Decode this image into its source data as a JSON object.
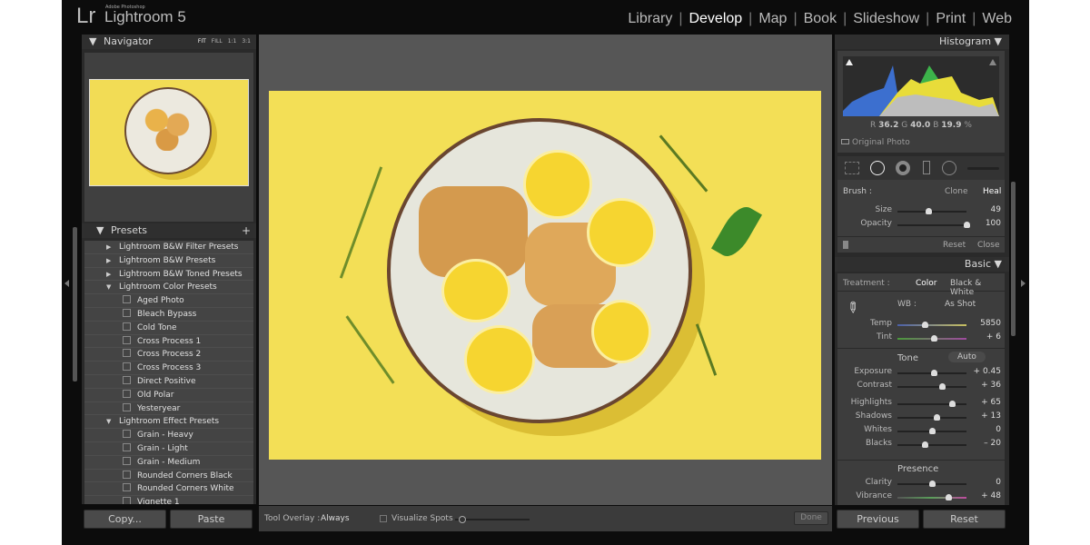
{
  "app": {
    "logo": "Lr",
    "vendor": "Adobe Photoshop",
    "name": "Lightroom 5"
  },
  "modules": [
    {
      "label": "Library"
    },
    {
      "label": "Develop",
      "active": true
    },
    {
      "label": "Map"
    },
    {
      "label": "Book"
    },
    {
      "label": "Slideshow"
    },
    {
      "label": "Print"
    },
    {
      "label": "Web"
    }
  ],
  "navigator": {
    "title": "Navigator",
    "zoom_options": [
      "FIT",
      "FILL",
      "1:1",
      "3:1"
    ]
  },
  "presets": {
    "title": "Presets",
    "add": "+",
    "items": [
      {
        "label": "Lightroom B&W Filter Presets",
        "type": "folder",
        "expanded": false
      },
      {
        "label": "Lightroom B&W Presets",
        "type": "folder",
        "expanded": false
      },
      {
        "label": "Lightroom B&W Toned Presets",
        "type": "folder",
        "expanded": false
      },
      {
        "label": "Lightroom Color Presets",
        "type": "folder",
        "expanded": true
      },
      {
        "label": "Aged Photo",
        "type": "preset"
      },
      {
        "label": "Bleach Bypass",
        "type": "preset"
      },
      {
        "label": "Cold Tone",
        "type": "preset"
      },
      {
        "label": "Cross Process 1",
        "type": "preset"
      },
      {
        "label": "Cross Process 2",
        "type": "preset"
      },
      {
        "label": "Cross Process 3",
        "type": "preset"
      },
      {
        "label": "Direct Positive",
        "type": "preset"
      },
      {
        "label": "Old Polar",
        "type": "preset"
      },
      {
        "label": "Yesteryear",
        "type": "preset"
      },
      {
        "label": "Lightroom Effect Presets",
        "type": "folder",
        "expanded": true
      },
      {
        "label": "Grain - Heavy",
        "type": "preset"
      },
      {
        "label": "Grain - Light",
        "type": "preset"
      },
      {
        "label": "Grain - Medium",
        "type": "preset"
      },
      {
        "label": "Rounded Corners Black",
        "type": "preset"
      },
      {
        "label": "Rounded Corners White",
        "type": "preset"
      },
      {
        "label": "Vignette 1",
        "type": "preset"
      }
    ]
  },
  "left_buttons": {
    "copy": "Copy...",
    "paste": "Paste"
  },
  "toolbar": {
    "tool_overlay_label": "Tool Overlay :",
    "tool_overlay_value": "Always",
    "visualize_spots": "Visualize Spots",
    "visualize_checked": false,
    "threshold_level": 0.1,
    "done": "Done"
  },
  "histogram": {
    "title": "Histogram",
    "r_label": "R",
    "r": "36.2",
    "g_label": "G",
    "g": "40.0",
    "b_label": "B",
    "b": "19.9",
    "unit": "%",
    "original_photo": "Original Photo"
  },
  "brush": {
    "label": "Brush :",
    "clone": "Clone",
    "heal": "Heal",
    "active": "Heal",
    "sliders": [
      {
        "label": "Size",
        "value": "49",
        "level": 0.45
      },
      {
        "label": "Opacity",
        "value": "100",
        "level": 1.0
      }
    ],
    "reset": "Reset",
    "close": "Close"
  },
  "basic": {
    "title": "Basic",
    "treatment_label": "Treatment :",
    "color": "Color",
    "bw": "Black & White",
    "wb_label": "WB :",
    "wb_value": "As Shot",
    "wb_sliders": [
      {
        "label": "Temp",
        "value": "5850",
        "level": 0.4,
        "track": "temp"
      },
      {
        "label": "Tint",
        "value": "+ 6",
        "level": 0.52,
        "track": "tint"
      }
    ],
    "tone_label": "Tone",
    "auto": "Auto",
    "tone_sliders": [
      {
        "label": "Exposure",
        "value": "+ 0.45",
        "level": 0.53
      },
      {
        "label": "Contrast",
        "value": "+ 36",
        "level": 0.65
      },
      {
        "label": "Highlights",
        "value": "+ 65",
        "level": 0.79
      },
      {
        "label": "Shadows",
        "value": "+ 13",
        "level": 0.57
      },
      {
        "label": "Whites",
        "value": "0",
        "level": 0.5
      },
      {
        "label": "Blacks",
        "value": "– 20",
        "level": 0.4
      }
    ],
    "presence_label": "Presence",
    "presence_sliders": [
      {
        "label": "Clarity",
        "value": "0",
        "level": 0.5
      },
      {
        "label": "Vibrance",
        "value": "+ 48",
        "level": 0.74,
        "track": "vib"
      }
    ]
  },
  "right_buttons": {
    "previous": "Previous",
    "reset": "Reset"
  },
  "colors": {
    "photo_bg": "#f3df56",
    "panel": "#3d3d3d",
    "app_bg": "#0c0c0c"
  }
}
